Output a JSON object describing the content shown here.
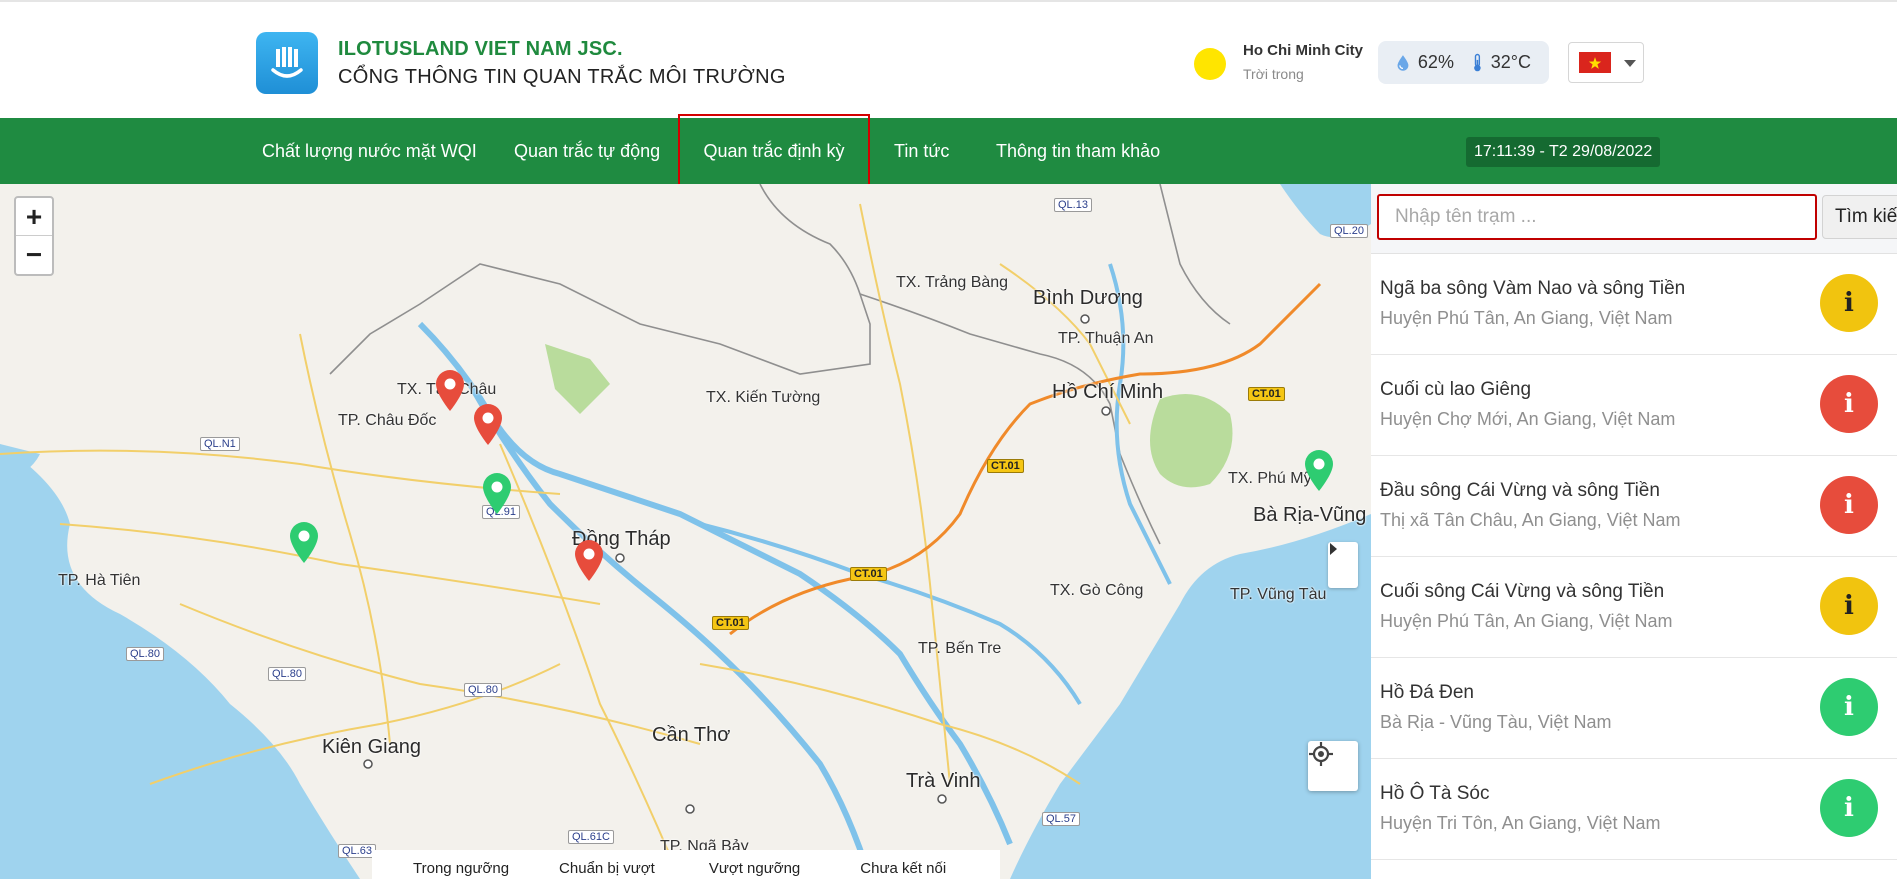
{
  "header": {
    "company": "ILOTUSLAND VIET NAM JSC.",
    "portal": "CỔNG THÔNG TIN QUAN TRẮC MÔI TRƯỜNG",
    "city": "Ho Chi Minh City",
    "weather_desc": "Trời trong",
    "humidity": "62%",
    "temperature": "32°C",
    "language_icon": "vietnam-flag-icon"
  },
  "nav": {
    "items": [
      {
        "label": "Chất lượng nước mặt WQI"
      },
      {
        "label": "Quan trắc tự động"
      },
      {
        "label": "Quan trắc định kỳ"
      },
      {
        "label": "Tin tức"
      },
      {
        "label": "Thông tin tham khảo"
      }
    ],
    "clock": "17:11:39 - T2 29/08/2022"
  },
  "map": {
    "zoom_in": "+",
    "zoom_out": "−",
    "labels": [
      "TX. Trảng Bàng",
      "Bình Dương",
      "TP. Thuận An",
      "Hồ Chí Minh",
      "TX. Tân Châu",
      "TP. Châu Đốc",
      "TX. Kiến Tường",
      "TX. Phú Mỹ",
      "Bà Rịa-Vũng Tàu",
      "TP. Hà Tiên",
      "Đồng Tháp",
      "TX. Gò Công",
      "TP. Vũng Tàu",
      "TP. Bến Tre",
      "Kiên Giang",
      "Cần Thơ",
      "Trà Vinh",
      "TP. Ngã Bảy"
    ],
    "roads": [
      "QL.13",
      "QL.20",
      "CT.01",
      "CT.01",
      "CT.01",
      "CT.01",
      "QL.N1",
      "QL.91",
      "QL.80",
      "QL.80",
      "QL.80",
      "QL.61C",
      "QL.57",
      "QL.63"
    ],
    "legend": [
      "Trong ngưỡng",
      "Chuẩn bị vượt",
      "Vượt ngưỡng",
      "Chưa kết nối"
    ],
    "colors": {
      "good": "#2ecc71",
      "exceed": "#e74c3c",
      "warn": "#f1c40f",
      "nav": "#1f8b41"
    }
  },
  "sidebar": {
    "search_placeholder": "Nhập tên trạm ...",
    "search_button": "Tìm kiếm",
    "stations": [
      {
        "name": "Ngã ba sông Vàm Nao và sông Tiền",
        "address": "Huyện Phú Tân, An Giang, Việt Nam",
        "status": "yellow"
      },
      {
        "name": "Cuối cù lao Giêng",
        "address": "Huyện Chợ Mới, An Giang, Việt Nam",
        "status": "red"
      },
      {
        "name": "Đầu sông Cái Vừng và sông Tiền",
        "address": "Thị xã Tân Châu, An Giang, Việt Nam",
        "status": "red"
      },
      {
        "name": "Cuối sông Cái Vừng và sông Tiền",
        "address": "Huyện Phú Tân, An Giang, Việt Nam",
        "status": "yellow"
      },
      {
        "name": "Hồ Đá Đen",
        "address": "Bà Rịa - Vũng Tàu, Việt Nam",
        "status": "green"
      },
      {
        "name": "Hồ Ô Tà Sóc",
        "address": "Huyện Tri Tôn, An Giang, Việt Nam",
        "status": "green"
      }
    ]
  }
}
